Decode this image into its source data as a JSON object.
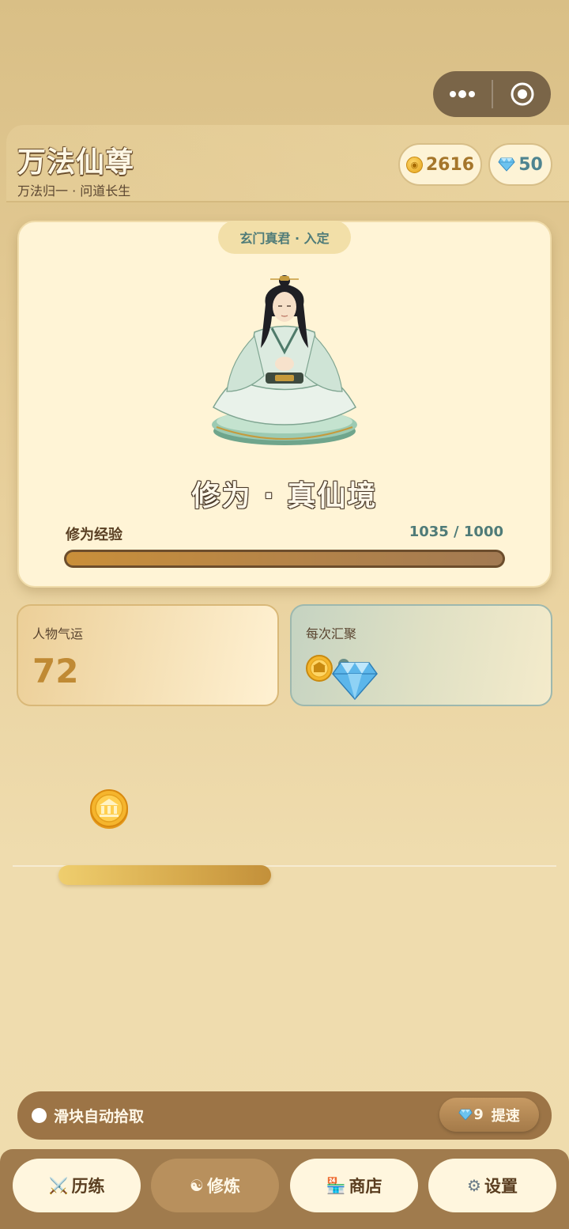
{
  "header": {
    "title": "万法仙尊",
    "subtitle": "万法归一 · 问道长生",
    "coins": "2616",
    "gems": "50"
  },
  "character": {
    "status": "玄门真君 · 入定",
    "realm": "修为 · 真仙境",
    "exp_label": "修为经验",
    "exp_value": "1035 / 1000",
    "exp_progress": 1.0
  },
  "stats": {
    "luck_label": "人物气运",
    "luck_value": "72",
    "gather_label": "每次汇聚"
  },
  "auto": {
    "label": "滑块自动拾取",
    "speed_cost": "9",
    "speed_label": "提速"
  },
  "nav": [
    {
      "icon": "⚔️",
      "label": "历练",
      "active": false
    },
    {
      "icon": "☯",
      "label": "修炼",
      "active": true
    },
    {
      "icon": "🏪",
      "label": "商店",
      "active": false
    },
    {
      "icon": "⚙",
      "label": "设置",
      "active": false
    }
  ],
  "colors": {
    "accent_gold": "#c08a34",
    "accent_teal": "#4f7b78",
    "nav_bg": "#a07b4d"
  }
}
